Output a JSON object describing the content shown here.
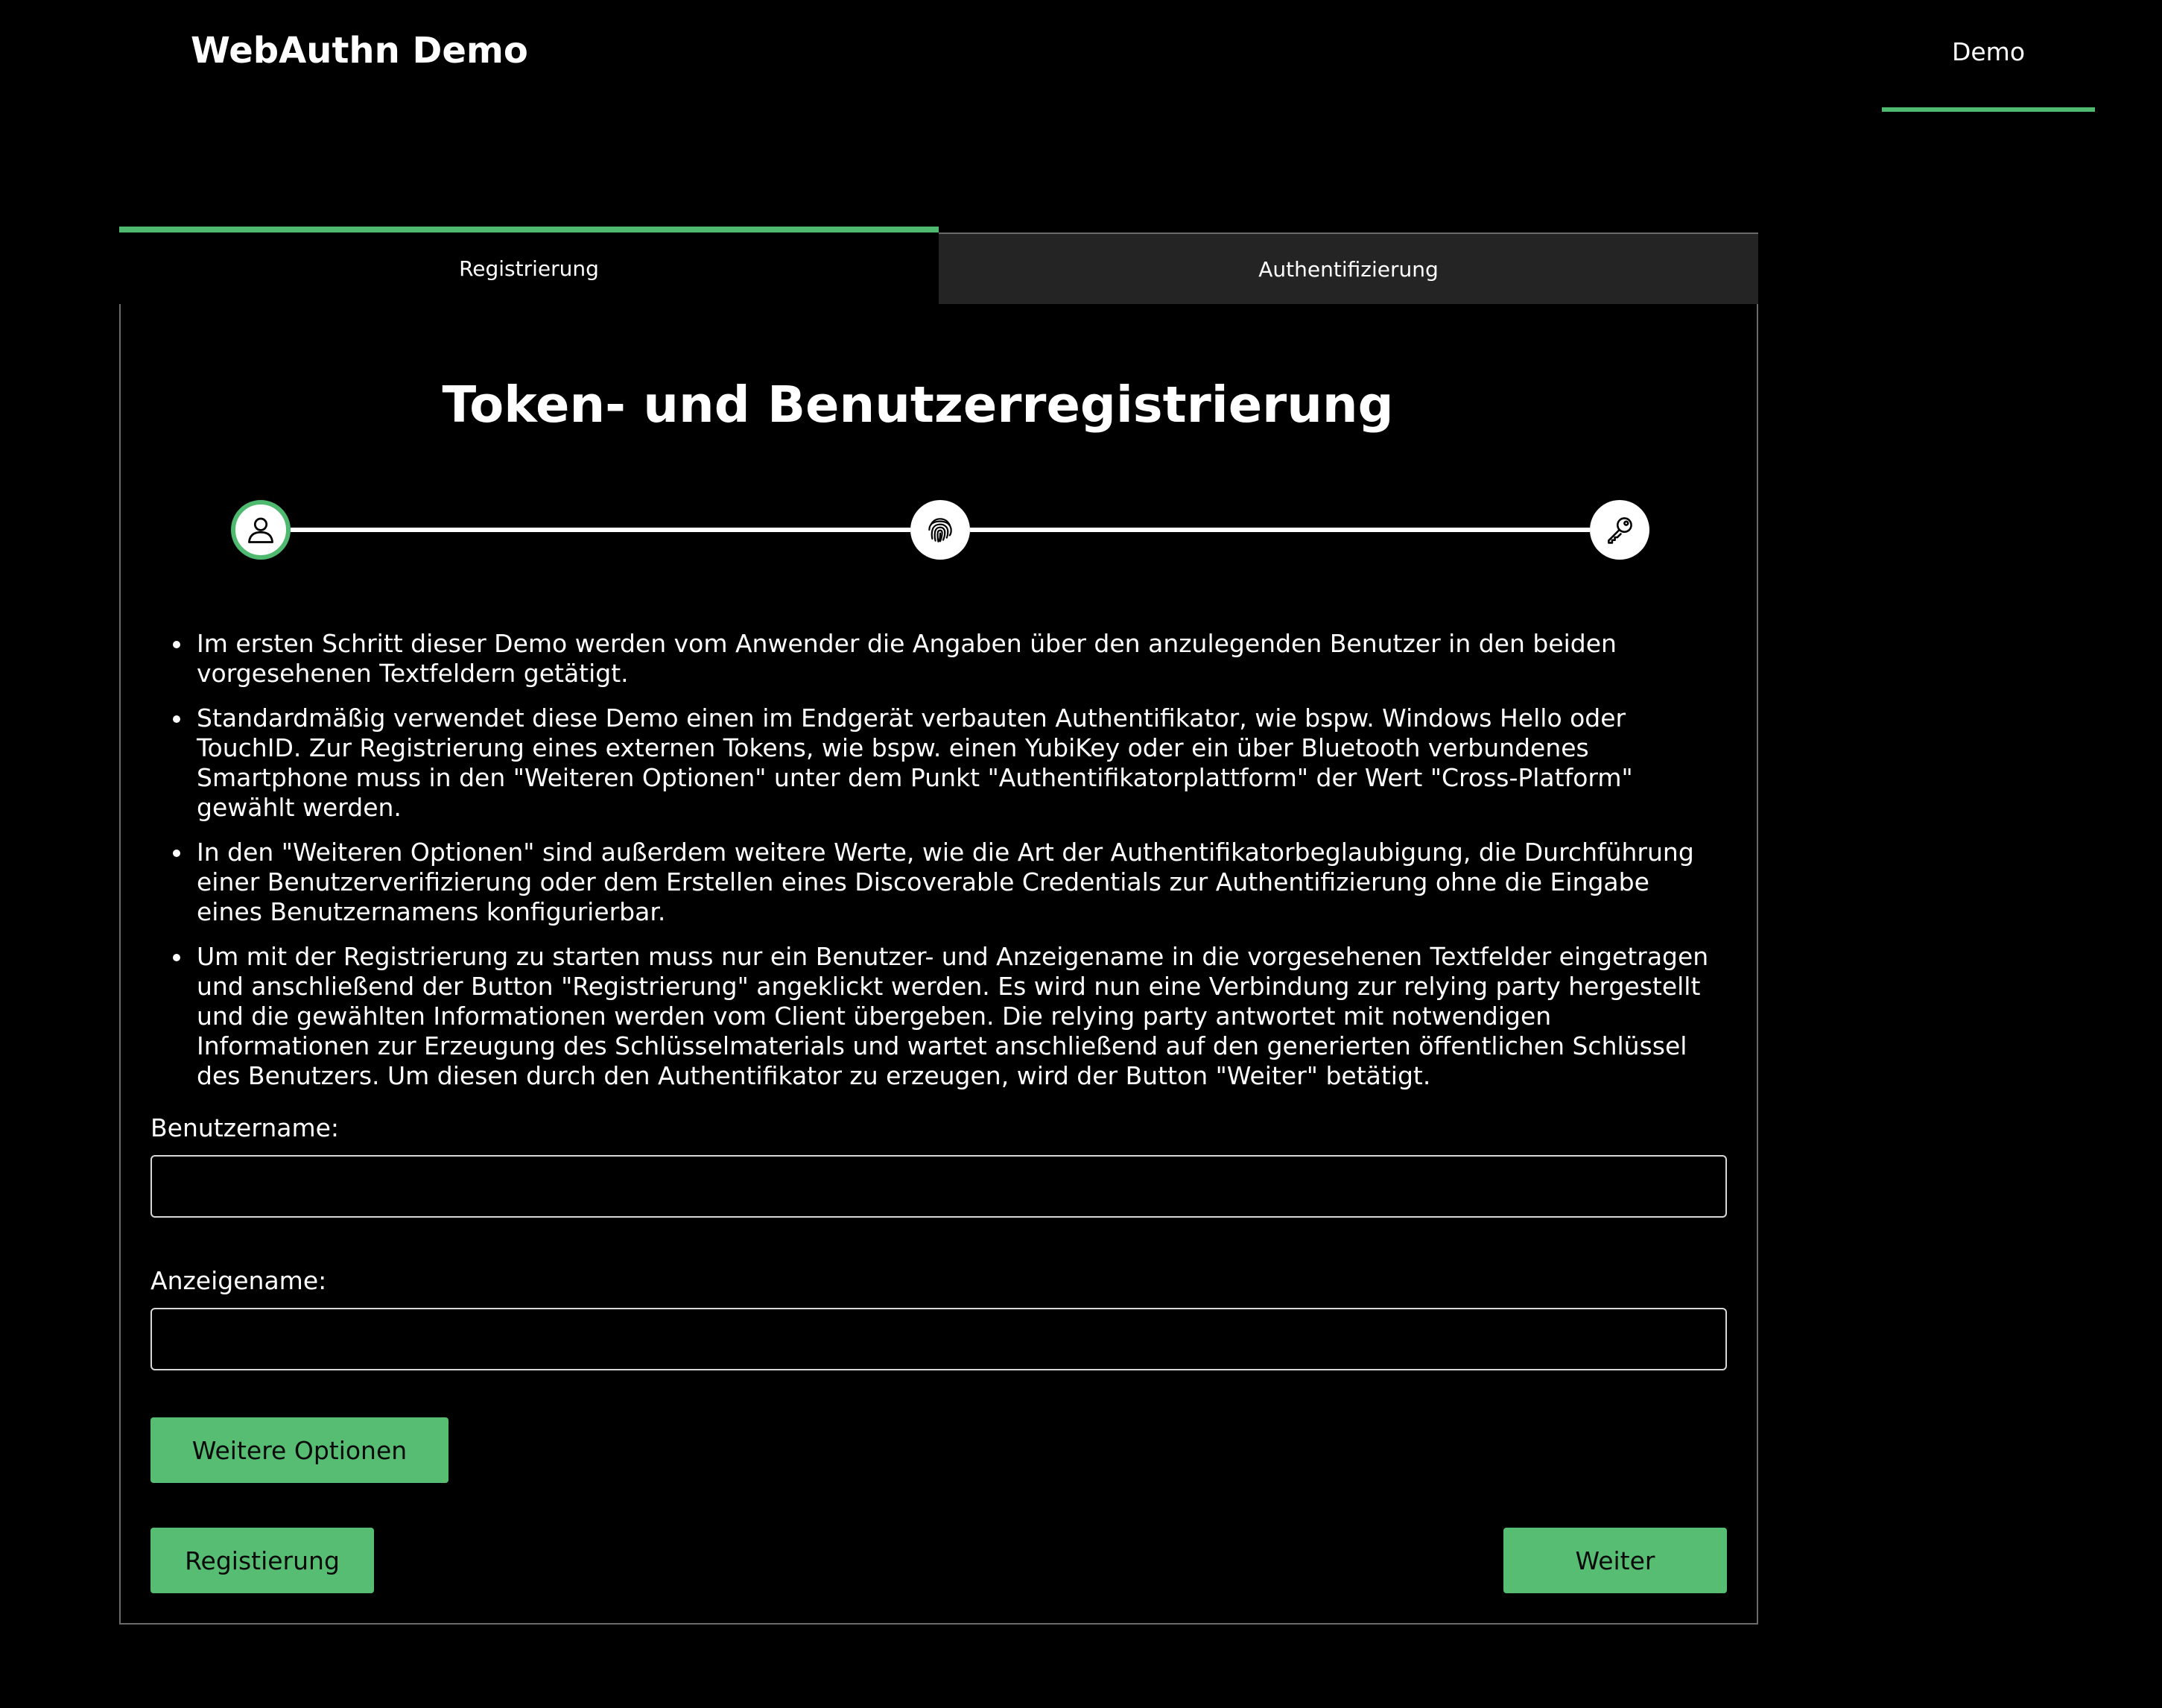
{
  "header": {
    "brand": "WebAuthn Demo",
    "nav_link": "Demo"
  },
  "colors": {
    "accent": "#4fb96f",
    "button": "#56bd73",
    "background": "#000000",
    "inactive_tab": "#242424"
  },
  "tabs": [
    {
      "label": "Registrierung",
      "active": true
    },
    {
      "label": "Authentifizierung",
      "active": false
    }
  ],
  "main": {
    "title": "Token- und Benutzerregistrierung",
    "steps": [
      {
        "icon": "user-icon",
        "active": true
      },
      {
        "icon": "fingerprint-icon",
        "active": false
      },
      {
        "icon": "key-icon",
        "active": false
      }
    ],
    "info": [
      "Im ersten Schritt dieser Demo werden vom Anwender die Angaben über den anzulegenden Benutzer in den beiden vorgesehenen Textfeldern getätigt.",
      "Standardmäßig verwendet diese Demo einen im Endgerät verbauten Authentifikator, wie bspw. Windows Hello oder TouchID. Zur Registrierung eines externen Tokens, wie bspw. einen YubiKey oder ein über Bluetooth verbundenes Smartphone muss in den \"Weiteren Optionen\" unter dem Punkt \"Authentifikatorplattform\" der Wert \"Cross-Platform\" gewählt werden.",
      "In den \"Weiteren Optionen\" sind außerdem weitere Werte, wie die Art der Authentifikatorbeglaubigung, die Durchführung einer Benutzerverifizierung oder dem Erstellen eines Discoverable Credentials zur Authentifizierung ohne die Eingabe eines Benutzernamens konfigurierbar.",
      "Um mit der Registrierung zu starten muss nur ein Benutzer- und Anzeigename in die vorgesehenen Textfelder eingetragen und anschließend der Button \"Registrierung\" angeklickt werden. Es wird nun eine Verbindung zur relying party hergestellt und die gewählten Informationen werden vom Client übergeben. Die relying party antwortet mit notwendigen Informationen zur Erzeugung des Schlüsselmaterials und wartet anschließend auf den generierten öffentlichen Schlüssel des Benutzers. Um diesen durch den Authentifikator zu erzeugen, wird der Button \"Weiter\" betätigt."
    ],
    "username": {
      "label": "Benutzername:",
      "value": "",
      "placeholder": ""
    },
    "displayname": {
      "label": "Anzeigename:",
      "value": "",
      "placeholder": ""
    },
    "more_options_label": "Weitere Optionen",
    "register_label": "Registierung",
    "next_label": "Weiter"
  }
}
